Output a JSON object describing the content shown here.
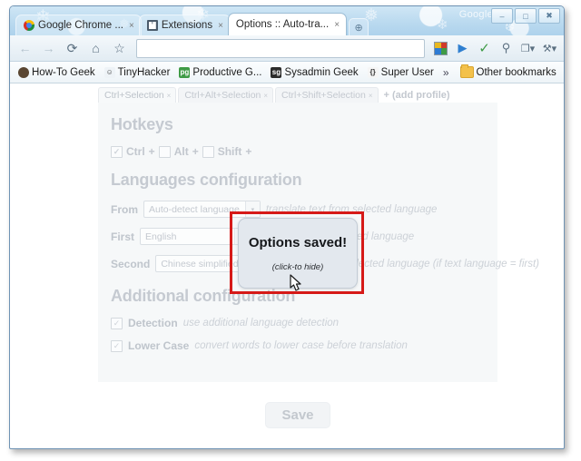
{
  "window": {
    "watermark": "Google",
    "controls": [
      {
        "name": "minimize",
        "glyph": "–"
      },
      {
        "name": "maximize",
        "glyph": "□"
      },
      {
        "name": "close",
        "glyph": "✖"
      }
    ]
  },
  "tabs": [
    {
      "title": "Google Chrome ...",
      "favicon": "chrome-icon",
      "active": false,
      "close": "×"
    },
    {
      "title": "Extensions",
      "favicon": "extensions-icon",
      "active": false,
      "close": "×"
    },
    {
      "title": "Options :: Auto-tra...",
      "favicon": "none",
      "active": true,
      "close": "×"
    }
  ],
  "newtab_glyph": "⊕",
  "toolbar": {
    "back": "←",
    "forward": "→",
    "reload": "⟳",
    "home": "⌂",
    "star": "☆",
    "address_value": "",
    "address_placeholder": "",
    "right_icons": [
      {
        "name": "color-swatch-icon",
        "glyph": ""
      },
      {
        "name": "play-icon",
        "glyph": "▶"
      },
      {
        "name": "checkmark-icon",
        "glyph": "✓"
      },
      {
        "name": "search-magnifier-icon",
        "glyph": "⚲"
      },
      {
        "name": "page-menu-icon",
        "glyph": "❐▾"
      },
      {
        "name": "wrench-menu-icon",
        "glyph": "⚒▾"
      }
    ]
  },
  "bookmarks": {
    "items": [
      {
        "label": "How-To Geek",
        "icon_bg": "#5a4632",
        "icon_text": "G"
      },
      {
        "label": "TinyHacker",
        "icon_bg": "#e8eef3",
        "icon_text": "Ũ"
      },
      {
        "label": "Productive G...",
        "icon_bg": "#3f9b46",
        "icon_text": "pg"
      },
      {
        "label": "Sysadmin Geek",
        "icon_bg": "#2b2b2b",
        "icon_text": "sg"
      },
      {
        "label": "Super User",
        "icon_bg": "#f7f7f7",
        "icon_text": "{}"
      }
    ],
    "overflow_glyph": "»",
    "other_label": "Other bookmarks"
  },
  "page": {
    "profile_tabs": [
      {
        "label": "Ctrl+Selection",
        "close": "×",
        "active": true
      },
      {
        "label": "Ctrl+Alt+Selection",
        "close": "×",
        "active": false
      },
      {
        "label": "Ctrl+Shift+Selection",
        "close": "×",
        "active": false
      }
    ],
    "add_profile_label": "+ (add profile)",
    "hotkeys": {
      "heading": "Hotkeys",
      "modifiers": [
        {
          "label": "Ctrl",
          "checked": true,
          "plus": "+"
        },
        {
          "label": "Alt",
          "checked": false,
          "plus": "+"
        },
        {
          "label": "Shift",
          "checked": false,
          "plus": "+"
        }
      ],
      "check_glyph": "✓"
    },
    "languages": {
      "heading": "Languages configuration",
      "rows": [
        {
          "label": "From",
          "value": "Auto-detect language",
          "arrow": "▾",
          "hint": "translate text from selected language"
        },
        {
          "label": "First",
          "value": "English",
          "arrow": "▾",
          "hint": "translate text to selected language"
        },
        {
          "label": "Second",
          "value": "Chinese simplified",
          "arrow": "▾",
          "hint": "translate text to selected language (if text language = first)"
        }
      ]
    },
    "additional": {
      "heading": "Additional configuration",
      "options": [
        {
          "label": "Detection",
          "hint": "use additional language detection",
          "checked": true
        },
        {
          "label": "Lower Case",
          "hint": "convert words to lower case before translation",
          "checked": true
        }
      ],
      "check_glyph": "✓"
    },
    "save_label": "Save"
  },
  "saved_dialog": {
    "title": "Options saved!",
    "subtitle": "(click-to hide)",
    "highlight_color": "#d61a18"
  }
}
